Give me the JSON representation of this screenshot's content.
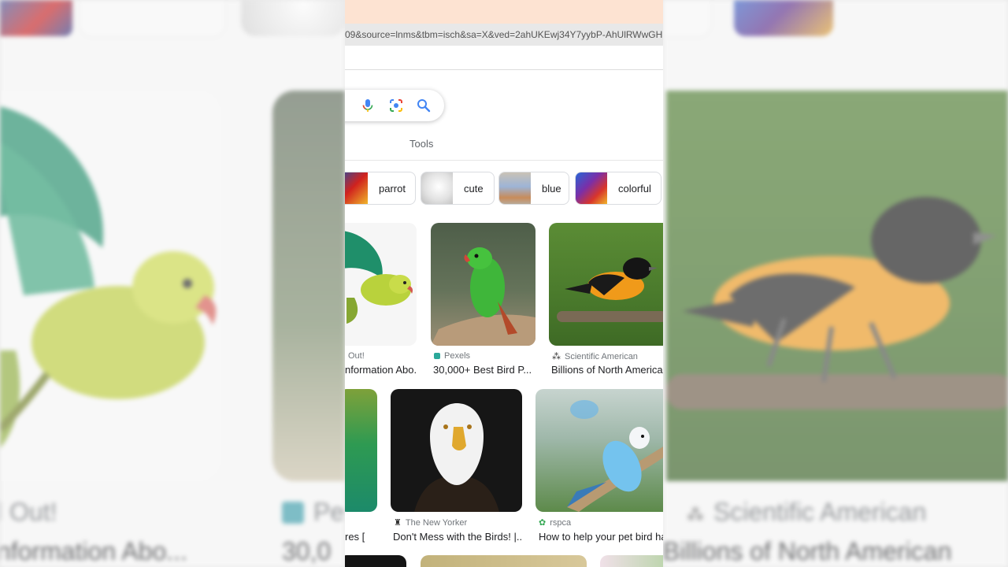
{
  "browser": {
    "url": "09&source=lnms&tbm=isch&sa=X&ved=2ahUKEwj34Y7yybP-AhUlRWwGH"
  },
  "search": {
    "tools_label": "Tools",
    "voice_icon": "mic-icon",
    "lens_icon": "camera-lens-icon",
    "search_icon": "search-icon"
  },
  "chips": [
    {
      "label": "parrot"
    },
    {
      "label": "cute"
    },
    {
      "label": "blue"
    },
    {
      "label": "colorful"
    }
  ],
  "results_row1": [
    {
      "source": "Out!",
      "title": "nformation Abo..."
    },
    {
      "source": "Pexels",
      "title": "30,000+ Best Bird P..."
    },
    {
      "source": "Scientific American",
      "title": "Billions of North American"
    }
  ],
  "results_row2": [
    {
      "source": "",
      "title": "res ["
    },
    {
      "source": "The New Yorker",
      "title": "Don't Mess with the Birds! |..."
    },
    {
      "source": "rspca",
      "title": "How to help your pet bird ha"
    }
  ],
  "background": {
    "left_source": "l Out!",
    "left_title": "nformation Abo...",
    "mid_source": "Pe",
    "mid_title": "30,0",
    "right_source": "Scientific American",
    "right_title": "Billions of North American"
  },
  "colors": {
    "google_blue": "#4285f4",
    "google_red": "#ea4335",
    "google_yellow": "#fbbc05",
    "google_green": "#34a853"
  }
}
